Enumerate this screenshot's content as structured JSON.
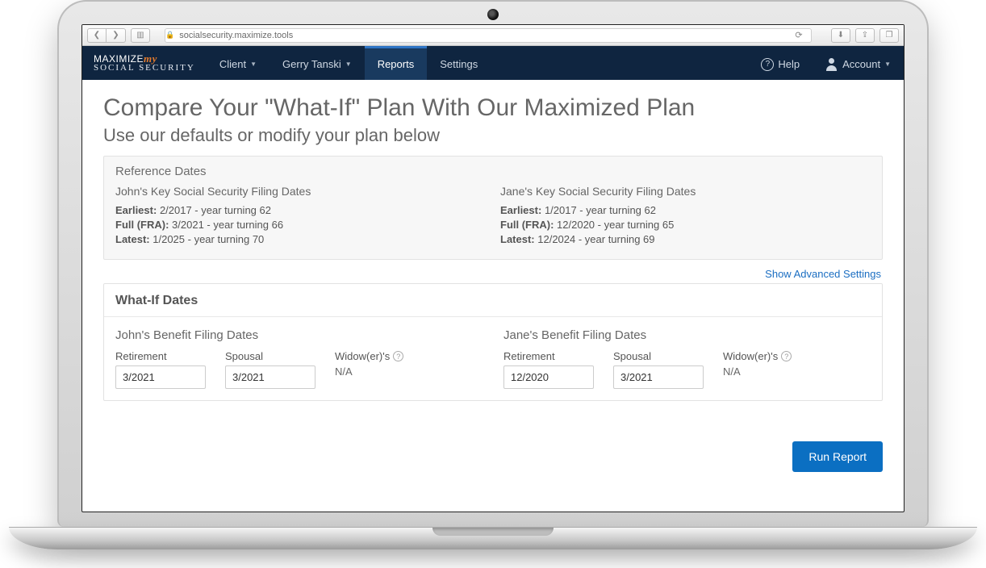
{
  "browser": {
    "url": "socialsecurity.maximize.tools"
  },
  "brand": {
    "line1a": "MAXIMIZE",
    "line1b": "my",
    "line2": "SOCIAL SECURITY"
  },
  "nav": {
    "client": "Client",
    "client_name": "Gerry Tanski",
    "reports": "Reports",
    "settings": "Settings",
    "help": "Help",
    "account": "Account"
  },
  "page": {
    "title": "Compare Your \"What-If\" Plan With Our Maximized Plan",
    "subtitle": "Use our defaults or modify your plan below"
  },
  "reference": {
    "heading": "Reference Dates",
    "persons": [
      {
        "heading": "John's Key Social Security Filing Dates",
        "earliest_label": "Earliest:",
        "earliest_value": "2/2017 - year turning 62",
        "fra_label": "Full (FRA):",
        "fra_value": "3/2021 - year turning 66",
        "latest_label": "Latest:",
        "latest_value": "1/2025 - year turning 70"
      },
      {
        "heading": "Jane's Key Social Security Filing Dates",
        "earliest_label": "Earliest:",
        "earliest_value": "1/2017 - year turning 62",
        "fra_label": "Full (FRA):",
        "fra_value": "12/2020 - year turning 65",
        "latest_label": "Latest:",
        "latest_value": "12/2024 - year turning 69"
      }
    ]
  },
  "advanced_link": "Show Advanced Settings",
  "whatif": {
    "heading": "What-If Dates",
    "persons": [
      {
        "heading": "John's Benefit Filing Dates",
        "retirement_label": "Retirement",
        "retirement_value": "3/2021",
        "spousal_label": "Spousal",
        "spousal_value": "3/2021",
        "widow_label": "Widow(er)'s",
        "widow_value": "N/A"
      },
      {
        "heading": "Jane's Benefit Filing Dates",
        "retirement_label": "Retirement",
        "retirement_value": "12/2020",
        "spousal_label": "Spousal",
        "spousal_value": "3/2021",
        "widow_label": "Widow(er)'s",
        "widow_value": "N/A"
      }
    ]
  },
  "run_report": "Run Report"
}
